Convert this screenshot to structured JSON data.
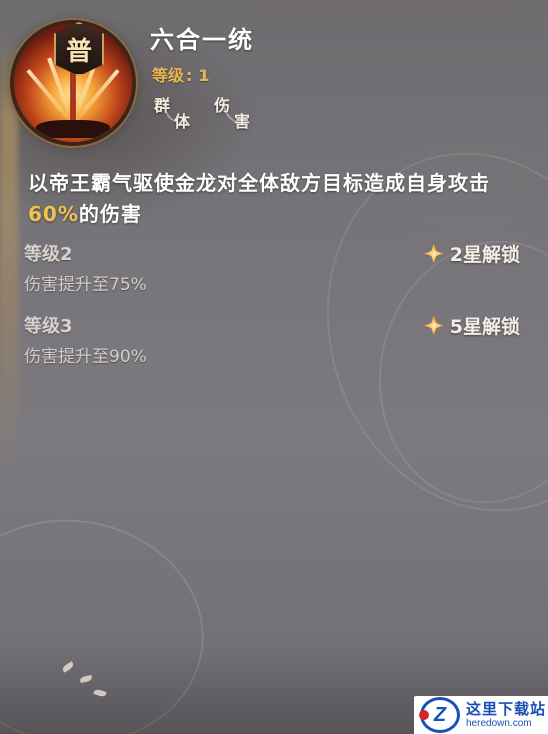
{
  "skill": {
    "grade": "普",
    "name": "六合一统",
    "level_label": "等级",
    "level_colon": ":",
    "level_value": "1",
    "tags": [
      {
        "c1": "群",
        "c2": "体"
      },
      {
        "c1": "伤",
        "c2": "害"
      }
    ],
    "description_prefix": "以帝王霸气驱使金龙对全体敌方目标造成自身攻击",
    "description_highlight": "60%",
    "description_suffix": "的伤害"
  },
  "upgrades": [
    {
      "level": "等级2",
      "effect": "伤害提升至75%",
      "unlock": "2星解锁"
    },
    {
      "level": "等级3",
      "effect": "伤害提升至90%",
      "unlock": "5星解锁"
    }
  ],
  "watermark": {
    "logo_letter": "Z",
    "text_cn": "这里下载站",
    "text_en": "heredown.com"
  },
  "colors": {
    "highlight": "#f2c24b",
    "level_gold": "#e8b84f"
  }
}
